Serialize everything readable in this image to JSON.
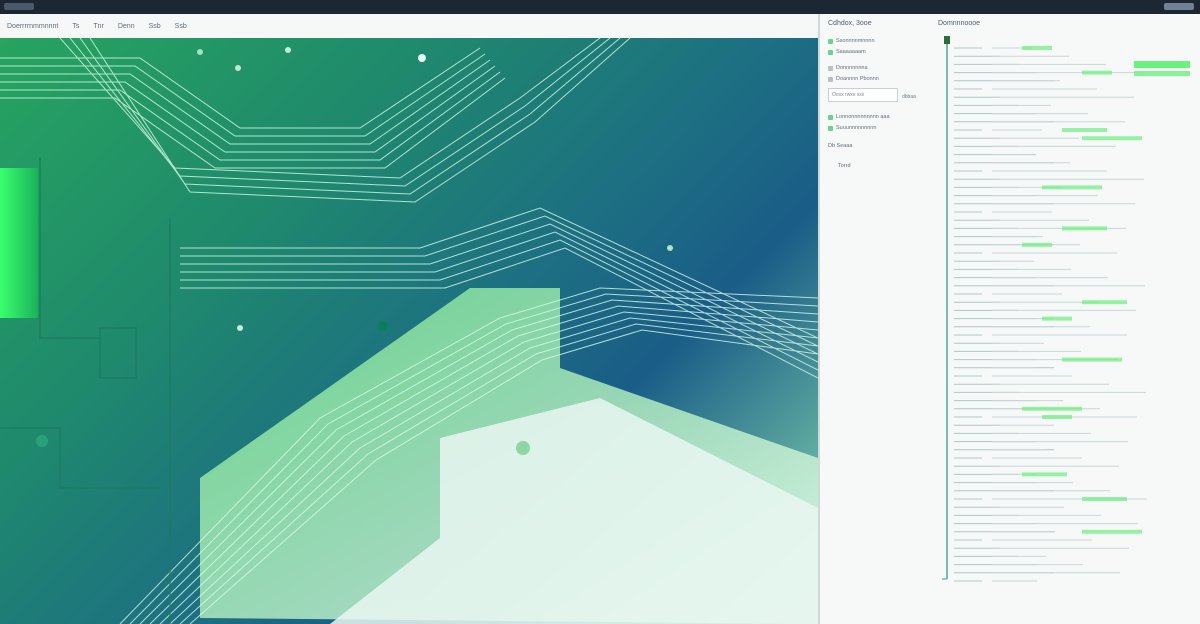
{
  "menu": {
    "items": [
      "Doerrrrnmmnnnt",
      "Ts",
      "Tnr",
      "Denn",
      "Ssb",
      "Ssb"
    ]
  },
  "panel": {
    "title_left": "Cdhdox, 3ooe",
    "title_right": "Domnnnoooe",
    "list": [
      {
        "label": "Ssonnnnmnnnn",
        "checked": true
      },
      {
        "label": "Saaaaaaam",
        "checked": true
      },
      {
        "label": "Donnnnnnna",
        "checked": false
      },
      {
        "label": "Doannnn Pbonnn",
        "checked": false
      }
    ],
    "field_value": "Ooxx rwxx xxx",
    "list2": [
      {
        "label": "Lonnonnnnnnnnn aaa",
        "checked": true
      },
      {
        "label": "Suuunnnnnnnnn",
        "checked": true
      }
    ],
    "small_a": "Db Seaaa",
    "small_b": "Torrd",
    "side_label": "dbbaa"
  },
  "colors": {
    "accent": "#6cf07e",
    "panel_bg": "#f7f9f9",
    "topbar": "#1c2733"
  },
  "icons": {
    "tree_node": "toggle-box-icon"
  }
}
